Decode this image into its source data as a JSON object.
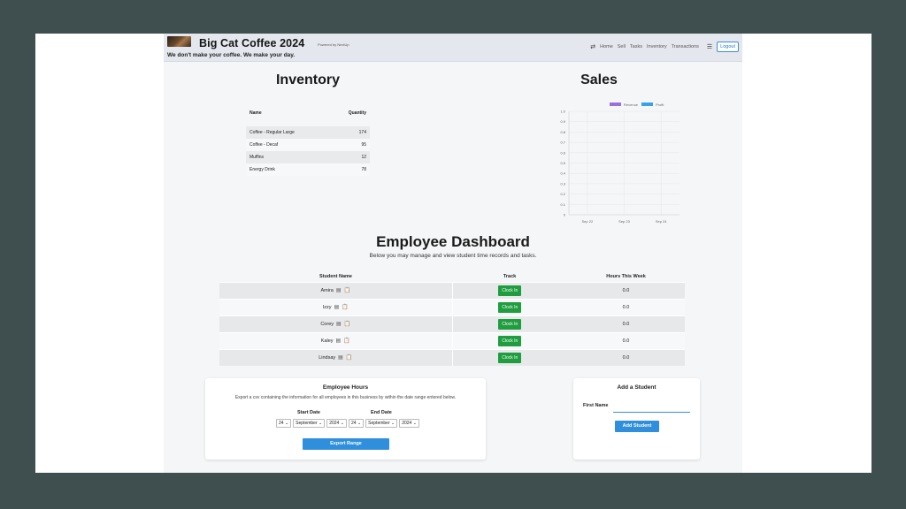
{
  "header": {
    "brand": "Big Cat Coffee 2024",
    "powered_by": "Powered by NextUp",
    "tagline": "We don't make your coffee. We make your day.",
    "nav": [
      "Home",
      "Sell",
      "Tasks",
      "Inventory",
      "Transactions"
    ],
    "logout": "Logout"
  },
  "inventory": {
    "title": "Inventory",
    "columns": [
      "Name",
      "Quantity"
    ],
    "rows": [
      {
        "name": "Coffee - Regular Large",
        "qty": "174"
      },
      {
        "name": "Coffee - Decaf",
        "qty": "95"
      },
      {
        "name": "Muffins",
        "qty": "12"
      },
      {
        "name": "Energy Drink",
        "qty": "78"
      }
    ]
  },
  "sales": {
    "title": "Sales"
  },
  "chart_data": {
    "type": "line",
    "x": [
      "Sep 22",
      "Sep 23",
      "Sep 24"
    ],
    "series": [
      {
        "name": "Revenue",
        "values": [],
        "color": "#9b6fe0"
      },
      {
        "name": "Profit",
        "values": [],
        "color": "#36a2eb"
      }
    ],
    "yticks": [
      "1.0",
      "0.9",
      "0.8",
      "0.7",
      "0.6",
      "0.5",
      "0.4",
      "0.3",
      "0.2",
      "0.1",
      "0"
    ],
    "ylim": [
      0,
      1
    ],
    "legend": "top",
    "grid": true
  },
  "employee": {
    "title": "Employee Dashboard",
    "subtitle": "Below you may manage and view student time records and tasks.",
    "columns": [
      "Student Name",
      "Track",
      "Hours This Week"
    ],
    "clock_label": "Clock In",
    "rows": [
      {
        "name": "Amira",
        "hours": "0.0"
      },
      {
        "name": "Izzy",
        "hours": "0.0"
      },
      {
        "name": "Corey",
        "hours": "0.0"
      },
      {
        "name": "Kaley",
        "hours": "0.0"
      },
      {
        "name": "Lindsay",
        "hours": "0.0"
      }
    ]
  },
  "hours_card": {
    "title": "Employee Hours",
    "description": "Export a csv containing the information for all employees in this business by within the date range entered below.",
    "start_label": "Start Date",
    "end_label": "End Date",
    "start": {
      "day": "24",
      "month": "September",
      "year": "2024"
    },
    "end": {
      "day": "24",
      "month": "September",
      "year": "2024"
    },
    "button": "Export Range"
  },
  "add_card": {
    "title": "Add a Student",
    "field_label": "First Name",
    "field_value": "",
    "button": "Add Student"
  },
  "colors": {
    "accent": "#2f8fdc",
    "clock_green": "#1f9d3f",
    "background": "#3f4f4f"
  }
}
